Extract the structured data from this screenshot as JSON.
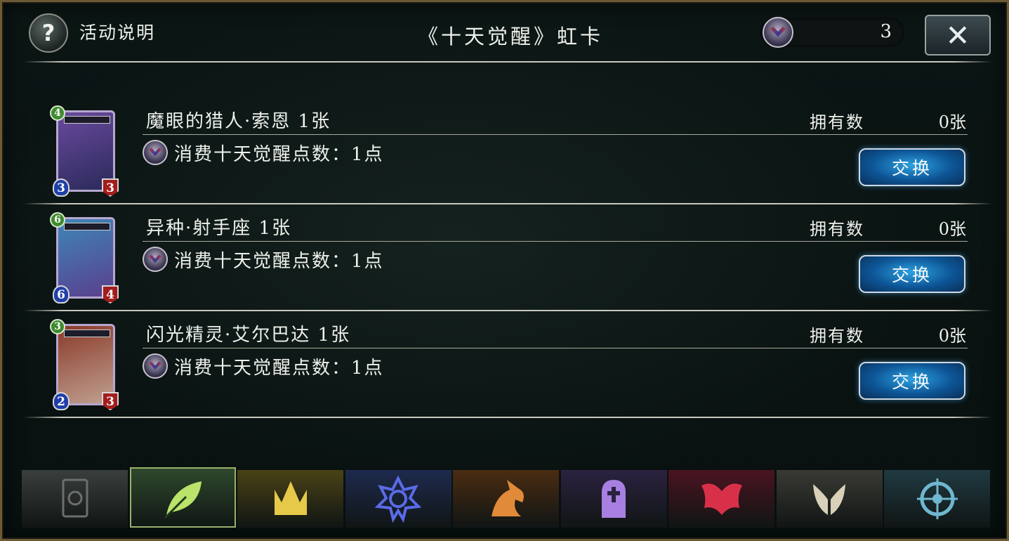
{
  "header": {
    "help_icon": "?",
    "help_label": "活动说明",
    "title": "《十天觉醒》虹卡",
    "points_value": "3",
    "close_icon": "✕"
  },
  "rows": [
    {
      "name": "魔眼的猎人·索恩 1张",
      "cost": "4",
      "atk": "3",
      "hp": "3",
      "owned_label": "拥有数",
      "owned_value": "0张",
      "cost_text": "消费十天觉醒点数：1点",
      "button": "交换",
      "art": [
        "#6a4a9e",
        "#2a2a5a"
      ]
    },
    {
      "name": "异种·射手座 1张",
      "cost": "6",
      "atk": "6",
      "hp": "4",
      "owned_label": "拥有数",
      "owned_value": "0张",
      "cost_text": "消费十天觉醒点数：1点",
      "button": "交换",
      "art": [
        "#3e86b8",
        "#5a3f8e"
      ]
    },
    {
      "name": "闪光精灵·艾尔巴达 1张",
      "cost": "3",
      "atk": "2",
      "hp": "3",
      "owned_label": "拥有数",
      "owned_value": "0张",
      "cost_text": "消费十天觉醒点数：1点",
      "button": "交换",
      "art": [
        "#8a3a2a",
        "#c0a090"
      ]
    }
  ],
  "tabs": [
    {
      "icon": "card-back-icon",
      "color": "#6c6f6a",
      "bg": "#3a3f3d"
    },
    {
      "icon": "leaf-icon",
      "color": "#b9e36a",
      "bg": "#2f4a2d"
    },
    {
      "icon": "crown-icon",
      "color": "#e7c94a",
      "bg": "#4a4216"
    },
    {
      "icon": "star-rune-icon",
      "color": "#5a6be8",
      "bg": "#1e2a4e"
    },
    {
      "icon": "dragon-icon",
      "color": "#e08a3a",
      "bg": "#4a2c12"
    },
    {
      "icon": "tombstone-icon",
      "color": "#a77fe0",
      "bg": "#2b2240"
    },
    {
      "icon": "bat-wings-icon",
      "color": "#d9304a",
      "bg": "#4a1420"
    },
    {
      "icon": "angel-wings-icon",
      "color": "#d8d1b8",
      "bg": "#3a3a34"
    },
    {
      "icon": "portal-icon",
      "color": "#6fb7d0",
      "bg": "#203a42"
    }
  ]
}
